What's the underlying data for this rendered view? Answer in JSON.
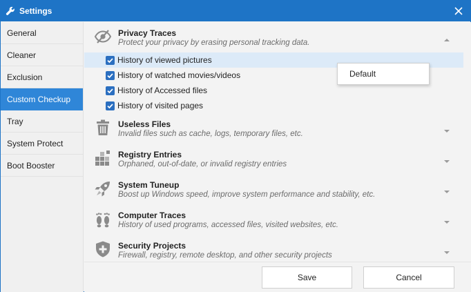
{
  "window": {
    "title": "Settings",
    "title_icon": "wrench-icon",
    "close_icon": "close-icon",
    "accent_color": "#1e74c6"
  },
  "sidebar": {
    "active_color": "#2f86d8",
    "items": [
      {
        "label": "General"
      },
      {
        "label": "Cleaner"
      },
      {
        "label": "Exclusion"
      },
      {
        "label": "Custom Checkup",
        "active": true
      },
      {
        "label": "Tray"
      },
      {
        "label": "System Protect"
      },
      {
        "label": "Boot Booster"
      }
    ]
  },
  "sections": [
    {
      "icon": "eye-slash-icon",
      "title": "Privacy Traces",
      "description": "Protect your privacy by erasing personal tracking data.",
      "expanded": true,
      "items": [
        {
          "label": "History of viewed pictures",
          "checked": true,
          "highlighted": true
        },
        {
          "label": "History of watched movies/videos",
          "checked": true
        },
        {
          "label": "History of Accessed files",
          "checked": true
        },
        {
          "label": "History of visited pages",
          "checked": true
        }
      ]
    },
    {
      "icon": "trash-icon",
      "title": "Useless Files",
      "description": "Invalid files such as cache, logs, temporary files, etc.",
      "expanded": false
    },
    {
      "icon": "blocks-icon",
      "title": "Registry Entries",
      "description": "Orphaned, out-of-date, or invalid registry entries",
      "expanded": false
    },
    {
      "icon": "rocket-icon",
      "title": "System Tuneup",
      "description": "Boost up Windows speed, improve system performance and stability, etc.",
      "expanded": false
    },
    {
      "icon": "footprints-icon",
      "title": "Computer Traces",
      "description": "History of used programs, accessed files, visited websites, etc.",
      "expanded": false
    },
    {
      "icon": "shield-plus-icon",
      "title": "Security Projects",
      "description": "Firewall, registry, remote desktop, and other security projects",
      "expanded": false
    }
  ],
  "context_menu": {
    "items": [
      {
        "label": "Default"
      }
    ]
  },
  "footer": {
    "save_label": "Save",
    "cancel_label": "Cancel"
  }
}
